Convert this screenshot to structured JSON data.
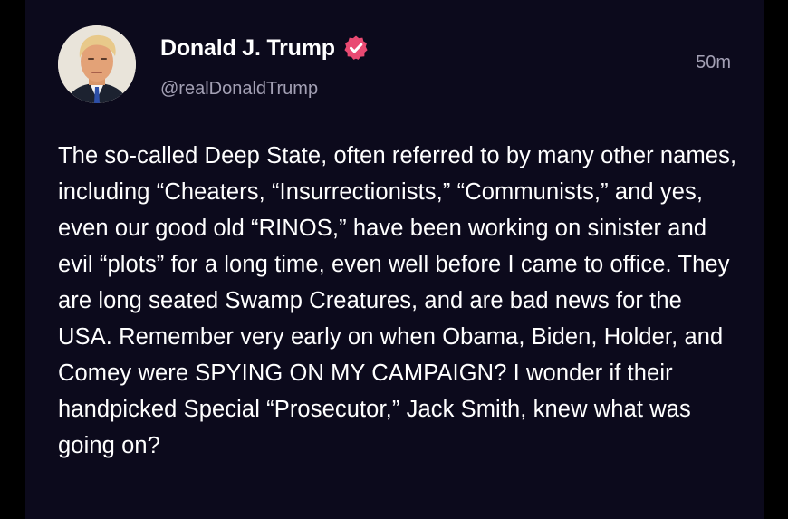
{
  "post": {
    "author": {
      "name": "Donald J. Trump",
      "handle": "@realDonaldTrump",
      "verified": true
    },
    "timestamp": "50m",
    "text": "The so-called Deep State, often referred to by many other names, including “Cheaters, “Insurrectionists,” “Communists,” and yes, even our good old “RINOS,” have been working on sinister and evil “plots” for a long time, even well before I came to office. They are long seated Swamp Creatures, and are bad news for the USA. Remember very early on when Obama, Biden, Holder, and Comey were SPYING ON MY CAMPAIGN? I wonder if their handpicked Special “Prosecutor,” Jack Smith, knew what was going on?"
  },
  "icons": {
    "verified": "verified-badge-icon",
    "avatar": "avatar-photo"
  },
  "colors": {
    "background": "#0c0a1c",
    "page": "#000000",
    "text": "#ffffff",
    "muted": "#a3a0b4",
    "verified_badge": "#e94a72"
  }
}
